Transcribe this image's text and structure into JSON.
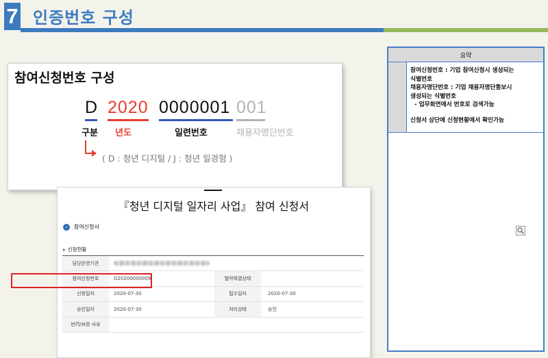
{
  "header": {
    "number": "7",
    "title": "인증번호 구성"
  },
  "code_card": {
    "title": "참여신청번호 구성",
    "segments": {
      "type_code": "D",
      "year_code": "2020",
      "serial_code": "0000001",
      "employer_code": "001"
    },
    "labels": {
      "type": "구분",
      "year": "년도",
      "serial": "일련번호",
      "employer": "채용자명단번호"
    },
    "note": "( D : 청년 디지털 / J : 청년 일경험 )"
  },
  "form": {
    "title": "『청년 디지털 일자리 사업』 참여 신청서",
    "section": "참여신청서",
    "subsection": "신청현황",
    "rows": [
      {
        "k1": "담당운영기관",
        "v1": "",
        "k2": "",
        "v2": ""
      },
      {
        "k1": "참여신청번호",
        "v1": "D20200000009",
        "k2": "협약체결상태",
        "v2": ""
      },
      {
        "k1": "신청일자",
        "v1": "2020-07-30",
        "k2": "접수일자",
        "v2": "2020-07-30"
      },
      {
        "k1": "승인일자",
        "v1": "2020-07-30",
        "k2": "처리상태",
        "v2": "승인"
      },
      {
        "k1": "반려/보완 사유",
        "v1": "",
        "k2": "",
        "v2": ""
      }
    ]
  },
  "summary": {
    "heading": "요약",
    "lines": [
      "참여신청번호 : 기업 참여신청시 생성되는",
      "식별번호",
      "채용자명단번호 : 기업 채용자명단통보시",
      "생성되는 식별번호",
      "  - 업무화면에서 번호로 검색가능"
    ],
    "footer_line": "신청서 상단에 신청현황에서 확인가능"
  },
  "colors": {
    "accent_blue": "#3d7bbf",
    "accent_green": "#97b85b",
    "highlight_red": "#e53c2e",
    "muted_gray": "#b3b3b3"
  },
  "icons": [
    "arrow-right-icon",
    "section-bullet-icon",
    "zoom-icon"
  ]
}
